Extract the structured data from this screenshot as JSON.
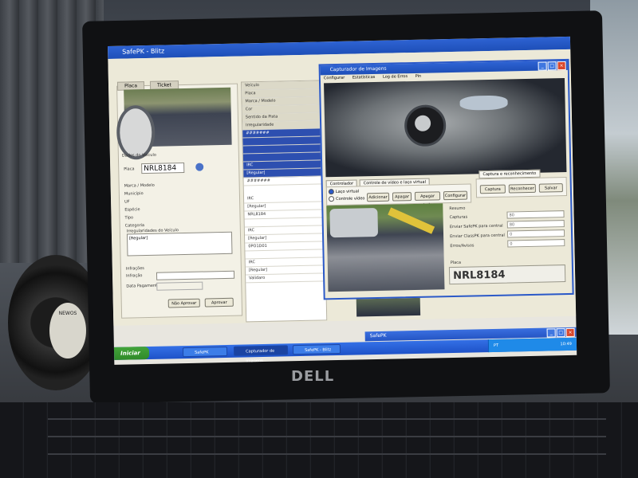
{
  "device": {
    "brand": "DELL"
  },
  "fan": {
    "label": "NEWOS"
  },
  "main_app": {
    "title": "SafePK - Blitz",
    "tabs": [
      "Placa",
      "Ticket"
    ],
    "left_panel": {
      "section_label": "Dados do Veículo",
      "plate_label": "Placa",
      "plate_value": "NRL8184",
      "fields": [
        "Marca / Modelo",
        "Município",
        "UF",
        "Espécie",
        "Tipo",
        "Categoria"
      ],
      "notes_label": "Irregularidades do Veículo",
      "notes_value": "[Regular]",
      "bottom_label": "Infrações",
      "checkbox_label": "Infração",
      "date_label": "Data Pagamento",
      "btn_ok": "Não Aprovar",
      "btn_cancel": "Aprovar"
    },
    "mid_panel": {
      "rows": [
        "Veículo",
        "Placa",
        "Marca / Modelo",
        "Cor",
        "Sentido da Pista",
        "Irregularidade",
        "#######",
        "",
        "",
        "",
        "IRC",
        "[Regular]",
        "#######"
      ],
      "rows2": [
        "IRC",
        "[Regular]",
        "NRL8184",
        "",
        "IRC",
        "[Regular]",
        "0PO1D01",
        "",
        "IRC",
        "[Regular]",
        "Validaro"
      ]
    }
  },
  "capture_window": {
    "title": "Capturador de Imagens",
    "menu": [
      "Configurar",
      "Estatísticas",
      "Log de Erros",
      "Pin"
    ],
    "tabs": [
      "Controlador",
      "Controle de vídeo e laço virtual"
    ],
    "capture_group_title": "Captura e reconhecimento",
    "radio_options": [
      "Laço virtual",
      "Controle vídeo"
    ],
    "video_buttons": [
      "Adicionar",
      "Apagar",
      "Apagar tudo",
      "Configurar"
    ],
    "capture_buttons": [
      "Captura",
      "Reconhecer",
      "Salvar"
    ],
    "stats_label": "Resumo",
    "stats": [
      {
        "label": "Capturas",
        "value": "80"
      },
      {
        "label": "Enviar SafePK para central",
        "value": "80"
      },
      {
        "label": "Enviar ClassPK para central",
        "value": "0"
      },
      {
        "label": "Erros/Avisos",
        "value": "0"
      }
    ],
    "plate_label": "Placa",
    "plate_value": "NRL8184"
  },
  "safepk_mini": {
    "title": "SafePK"
  },
  "taskbar": {
    "start": "Iniciar",
    "tasks": [
      "SafePK",
      "Capturador de Imagens",
      "SafePK - Blitz"
    ],
    "lang": "PT",
    "clock": "10:49"
  }
}
